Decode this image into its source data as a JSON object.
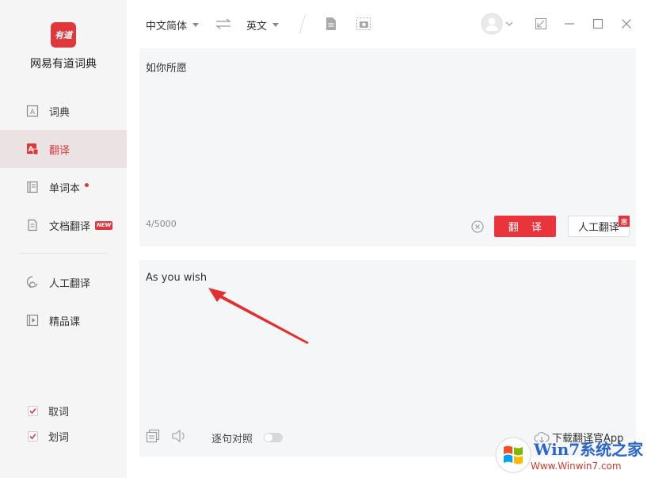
{
  "app": {
    "logo_text": "有道",
    "brand": "网易有道词典"
  },
  "sidebar": {
    "items": [
      {
        "label": "词典",
        "icon": "dictionary-icon"
      },
      {
        "label": "翻译",
        "icon": "translate-icon",
        "active": true
      },
      {
        "label": "单词本",
        "icon": "wordbook-icon",
        "dot": true
      },
      {
        "label": "文档翻译",
        "icon": "document-icon",
        "badge": "NEW"
      },
      {
        "label": "人工翻译",
        "icon": "human-translation-icon"
      },
      {
        "label": "精品课",
        "icon": "course-icon"
      }
    ],
    "options": [
      {
        "label": "取词",
        "checked": true
      },
      {
        "label": "划词",
        "checked": true
      }
    ]
  },
  "topbar": {
    "source_lang": "中文简体",
    "target_lang": "英文"
  },
  "input": {
    "text": "如你所愿",
    "char_count": "4/5000",
    "translate_label": "翻 译",
    "human_label": "人工翻译",
    "human_badge": "惠"
  },
  "output": {
    "text": "As you wish",
    "sentence_label": "逐句对照",
    "download_label": "下载翻译官App"
  },
  "watermark": {
    "line1": "Win7系统之家",
    "line2": "Www.Winwin7.com"
  },
  "colors": {
    "accent": "#e0373d",
    "panel_bg": "#f5f6f7",
    "sidebar_bg": "#f5f5f5",
    "active_bg": "#ebe3e3"
  }
}
